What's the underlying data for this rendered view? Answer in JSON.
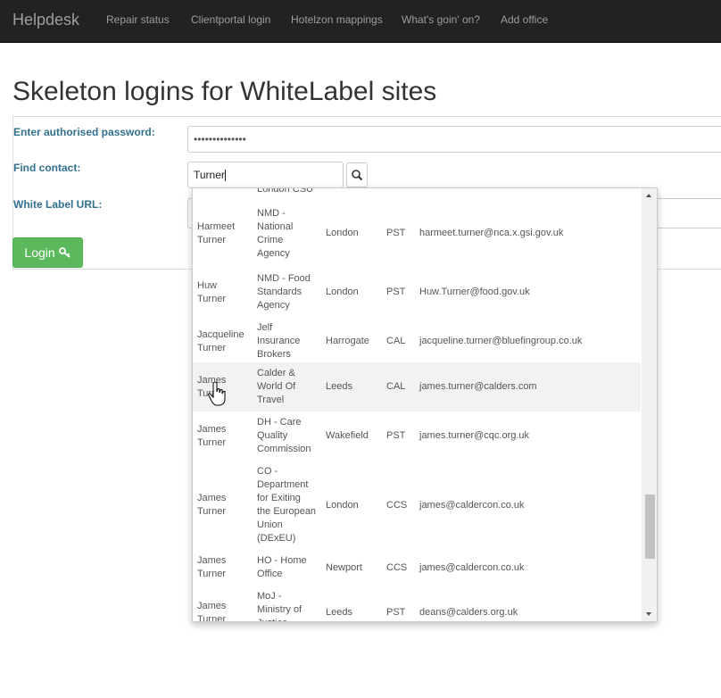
{
  "navbar": {
    "brand": "Helpdesk",
    "items": [
      "Repair status",
      "Clientportal login",
      "Hotelzon mappings",
      "What's goin' on?",
      "Add office"
    ]
  },
  "page": {
    "title": "Skeleton logins for WhiteLabel sites"
  },
  "form": {
    "password_label": "Enter authorised password:",
    "password_value": "••••••••••••••",
    "contact_label": "Find contact:",
    "contact_value": "Turner",
    "url_label": "White Label URL:",
    "login_label": "Login"
  },
  "dropdown": {
    "rows": [
      {
        "first": "",
        "last": "",
        "company": [
          "London CSU"
        ],
        "city": "",
        "code": "",
        "email": ""
      },
      {
        "first": "Harmeet",
        "last": "Turner",
        "company": [
          "NMD -",
          "National",
          "Crime",
          "Agency"
        ],
        "city": "London",
        "code": "PST",
        "email": "harmeet.turner@nca.x.gsi.gov.uk"
      },
      {
        "first": "Huw",
        "last": "Turner",
        "company": [
          "NMD - Food",
          "Standards",
          "Agency"
        ],
        "city": "London",
        "code": "PST",
        "email": "Huw.Turner@food.gov.uk"
      },
      {
        "first": "Jacqueline",
        "last": "Turner",
        "company": [
          "Jelf",
          "Insurance",
          "Brokers"
        ],
        "city": "Harrogate",
        "code": "CAL",
        "email": "jacqueline.turner@bluefingroup.co.uk"
      },
      {
        "first": "James",
        "last": "Turner",
        "company": [
          "Calder &",
          "World Of",
          "Travel"
        ],
        "city": "Leeds",
        "code": "CAL",
        "email": "james.turner@calders.com"
      },
      {
        "first": "James",
        "last": "Turner",
        "company": [
          "DH - Care",
          "Quality",
          "Commission"
        ],
        "city": "Wakefield",
        "code": "PST",
        "email": "james.turner@cqc.org.uk"
      },
      {
        "first": "James",
        "last": "Turner",
        "company": [
          "CO -",
          "Department",
          "for Exiting",
          "the European",
          "Union",
          "(DExEU)"
        ],
        "city": "London",
        "code": "CCS",
        "email": "james@caldercon.co.uk"
      },
      {
        "first": "James",
        "last": "Turner",
        "company": [
          "HO - Home",
          "Office"
        ],
        "city": "Newport",
        "code": "CCS",
        "email": "james@caldercon.co.uk"
      },
      {
        "first": "James",
        "last": "Turner",
        "company": [
          "MoJ -",
          "Ministry of",
          "Justice"
        ],
        "city": "Leeds",
        "code": "PST",
        "email": "deans@calders.org.uk"
      }
    ]
  }
}
